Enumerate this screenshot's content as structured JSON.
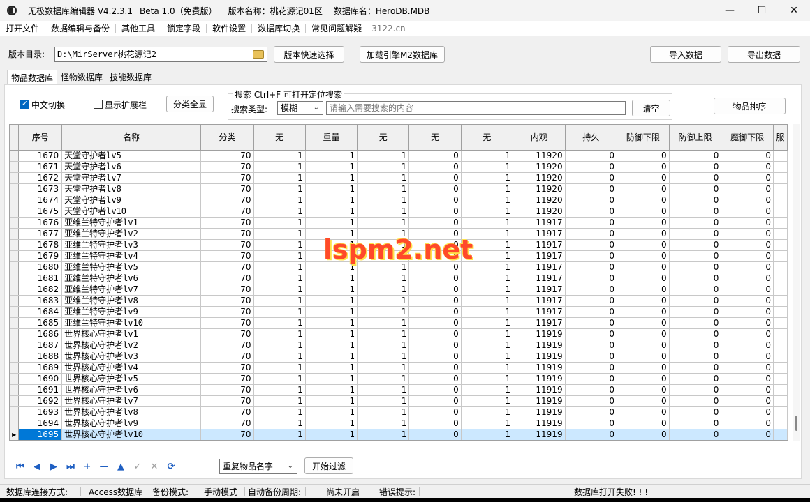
{
  "titlebar": {
    "app_name": "无极数据库编辑器 V4.2.3.1",
    "edition": "Beta 1.0（免费版）",
    "version_name": "版本名称：桃花源记01区",
    "db_name": "数据库名：HeroDB.MDB"
  },
  "menu": {
    "items": [
      "打开文件",
      "数据编辑与备份",
      "其他工具",
      "锁定字段",
      "软件设置",
      "数据库切换",
      "常见问题解疑"
    ],
    "note": "3122.cn"
  },
  "toolbar": {
    "dir_label": "版本目录:",
    "dir_value": "D:\\MirServer桃花源记2",
    "quick_select": "版本快速选择",
    "load_engine": "加载引擎M2数据库",
    "import": "导入数据",
    "export": "导出数据"
  },
  "tabs": [
    "物品数据库",
    "怪物数据库",
    "技能数据库"
  ],
  "filters": {
    "cn_toggle": "中文切换",
    "show_ext": "显示扩展栏",
    "show_all": "分类全显",
    "search_legend": "搜索  Ctrl+F 可打开定位搜索",
    "search_type_label": "搜索类型:",
    "search_type_value": "模糊",
    "search_placeholder": "请输入需要搜索的内容",
    "clear": "清空",
    "sort": "物品排序"
  },
  "grid": {
    "columns": [
      "序号",
      "名称",
      "分类",
      "无",
      "重量",
      "无",
      "无",
      "无",
      "内观",
      "持久",
      "防御下限",
      "防御上限",
      "魔御下限",
      "服"
    ],
    "rows": [
      [
        "1670",
        "天堂守护者lv5",
        "70",
        "1",
        "1",
        "1",
        "0",
        "1",
        "11920",
        "0",
        "0",
        "0",
        "0"
      ],
      [
        "1671",
        "天堂守护者lv6",
        "70",
        "1",
        "1",
        "1",
        "0",
        "1",
        "11920",
        "0",
        "0",
        "0",
        "0"
      ],
      [
        "1672",
        "天堂守护者lv7",
        "70",
        "1",
        "1",
        "1",
        "0",
        "1",
        "11920",
        "0",
        "0",
        "0",
        "0"
      ],
      [
        "1673",
        "天堂守护者lv8",
        "70",
        "1",
        "1",
        "1",
        "0",
        "1",
        "11920",
        "0",
        "0",
        "0",
        "0"
      ],
      [
        "1674",
        "天堂守护者lv9",
        "70",
        "1",
        "1",
        "1",
        "0",
        "1",
        "11920",
        "0",
        "0",
        "0",
        "0"
      ],
      [
        "1675",
        "天堂守护者lv10",
        "70",
        "1",
        "1",
        "1",
        "0",
        "1",
        "11920",
        "0",
        "0",
        "0",
        "0"
      ],
      [
        "1676",
        "亚维兰特守护者lv1",
        "70",
        "1",
        "1",
        "1",
        "0",
        "1",
        "11917",
        "0",
        "0",
        "0",
        "0"
      ],
      [
        "1677",
        "亚维兰特守护者lv2",
        "70",
        "1",
        "1",
        "1",
        "0",
        "1",
        "11917",
        "0",
        "0",
        "0",
        "0"
      ],
      [
        "1678",
        "亚维兰特守护者lv3",
        "70",
        "1",
        "1",
        "1",
        "0",
        "1",
        "11917",
        "0",
        "0",
        "0",
        "0"
      ],
      [
        "1679",
        "亚维兰特守护者lv4",
        "70",
        "1",
        "1",
        "1",
        "0",
        "1",
        "11917",
        "0",
        "0",
        "0",
        "0"
      ],
      [
        "1680",
        "亚维兰特守护者lv5",
        "70",
        "1",
        "1",
        "1",
        "0",
        "1",
        "11917",
        "0",
        "0",
        "0",
        "0"
      ],
      [
        "1681",
        "亚维兰特守护者lv6",
        "70",
        "1",
        "1",
        "1",
        "0",
        "1",
        "11917",
        "0",
        "0",
        "0",
        "0"
      ],
      [
        "1682",
        "亚维兰特守护者lv7",
        "70",
        "1",
        "1",
        "1",
        "0",
        "1",
        "11917",
        "0",
        "0",
        "0",
        "0"
      ],
      [
        "1683",
        "亚维兰特守护者lv8",
        "70",
        "1",
        "1",
        "1",
        "0",
        "1",
        "11917",
        "0",
        "0",
        "0",
        "0"
      ],
      [
        "1684",
        "亚维兰特守护者lv9",
        "70",
        "1",
        "1",
        "1",
        "0",
        "1",
        "11917",
        "0",
        "0",
        "0",
        "0"
      ],
      [
        "1685",
        "亚维兰特守护者lv10",
        "70",
        "1",
        "1",
        "1",
        "0",
        "1",
        "11917",
        "0",
        "0",
        "0",
        "0"
      ],
      [
        "1686",
        "世界核心守护者lv1",
        "70",
        "1",
        "1",
        "1",
        "0",
        "1",
        "11919",
        "0",
        "0",
        "0",
        "0"
      ],
      [
        "1687",
        "世界核心守护者lv2",
        "70",
        "1",
        "1",
        "1",
        "0",
        "1",
        "11919",
        "0",
        "0",
        "0",
        "0"
      ],
      [
        "1688",
        "世界核心守护者lv3",
        "70",
        "1",
        "1",
        "1",
        "0",
        "1",
        "11919",
        "0",
        "0",
        "0",
        "0"
      ],
      [
        "1689",
        "世界核心守护者lv4",
        "70",
        "1",
        "1",
        "1",
        "0",
        "1",
        "11919",
        "0",
        "0",
        "0",
        "0"
      ],
      [
        "1690",
        "世界核心守护者lv5",
        "70",
        "1",
        "1",
        "1",
        "0",
        "1",
        "11919",
        "0",
        "0",
        "0",
        "0"
      ],
      [
        "1691",
        "世界核心守护者lv6",
        "70",
        "1",
        "1",
        "1",
        "0",
        "1",
        "11919",
        "0",
        "0",
        "0",
        "0"
      ],
      [
        "1692",
        "世界核心守护者lv7",
        "70",
        "1",
        "1",
        "1",
        "0",
        "1",
        "11919",
        "0",
        "0",
        "0",
        "0"
      ],
      [
        "1693",
        "世界核心守护者lv8",
        "70",
        "1",
        "1",
        "1",
        "0",
        "1",
        "11919",
        "0",
        "0",
        "0",
        "0"
      ],
      [
        "1694",
        "世界核心守护者lv9",
        "70",
        "1",
        "1",
        "1",
        "0",
        "1",
        "11919",
        "0",
        "0",
        "0",
        "0"
      ],
      [
        "1695",
        "世界核心守护者lv10",
        "70",
        "1",
        "1",
        "1",
        "0",
        "1",
        "11919",
        "0",
        "0",
        "0",
        "0"
      ]
    ],
    "selected_row": "1695"
  },
  "bottom": {
    "filter_select": "重复物品名字",
    "start_filter": "开始过滤"
  },
  "status": {
    "conn_label": "数据库连接方式:",
    "conn_value": "Access数据库",
    "backup_label": "备份模式:",
    "backup_value": "手动模式",
    "auto_label": "自动备份周期:",
    "auto_value": "尚未开启",
    "error_label": "错误提示:",
    "error_value": "数据库打开失败! ! !"
  },
  "watermark": "lspm2.net",
  "colors": {
    "selection": "#cce8ff",
    "selected_cell": "#0078d7",
    "nav_icon": "#1f5fc2",
    "watermark": "#ff4a2a"
  }
}
